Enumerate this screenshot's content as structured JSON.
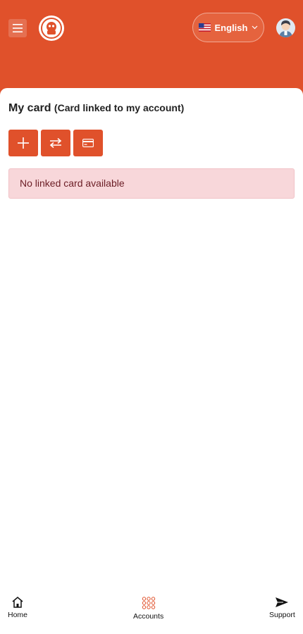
{
  "header": {
    "menu_icon": "hamburger-icon",
    "logo_icon": "brand-logo",
    "language": {
      "label": "English",
      "flag": "us-flag-icon",
      "chevron": "chevron-down-icon"
    },
    "avatar_icon": "user-avatar-icon"
  },
  "page": {
    "title": "My card",
    "subtitle": "(Card linked to my account)",
    "actions": [
      {
        "icon": "plus-icon"
      },
      {
        "icon": "swap-icon"
      },
      {
        "icon": "credit-card-icon"
      }
    ],
    "empty_message": "No linked card available"
  },
  "bottom_nav": [
    {
      "label": "Home",
      "icon": "home-icon"
    },
    {
      "label": "Accounts",
      "icon": "grid-icon"
    },
    {
      "label": "Support",
      "icon": "send-icon"
    }
  ],
  "colors": {
    "primary": "#e0512b",
    "alert_bg": "#f8d7da",
    "alert_text": "#6b1d25"
  }
}
